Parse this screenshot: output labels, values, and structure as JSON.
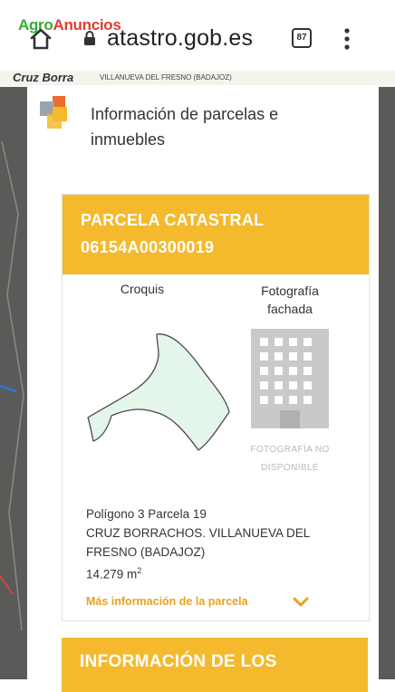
{
  "browser": {
    "url": "atastro.gob.es",
    "tab_count": "87",
    "watermark_part1": "Agro",
    "watermark_part2": "Anuncios"
  },
  "map": {
    "label": "Cruz Borra",
    "sublabel": "VILLANUEVA DEL FRESNO (BADAJOZ)"
  },
  "panel": {
    "title": "Información de parcelas e inmuebles"
  },
  "parcel_card": {
    "heading_line1": "PARCELA CATASTRAL",
    "heading_line2": "06154A00300019",
    "croquis_label": "Croquis",
    "photo_label": "Fotografía fachada",
    "photo_unavailable": "FOTOGRAFÍA NO DISPONIBLE",
    "poligono": "Polígono 3 Parcela 19",
    "address_line1": "CRUZ BORRACHOS. VILLANUEVA DEL",
    "address_line2": "FRESNO (BADAJOZ)",
    "area_value": "14.279 m",
    "area_unit_sup": "2",
    "more_link": "Más información de la parcela"
  },
  "second_card": {
    "heading": "INFORMACIÓN DE LOS"
  },
  "colors": {
    "accent": "#f5b92e",
    "link": "#e9a21f",
    "watermark_green": "#3aa935",
    "watermark_red": "#e03c2f",
    "parcel_fill": "#e4f5e9"
  },
  "icons": [
    "home-icon",
    "lock-icon",
    "tabs-icon",
    "menu-dots-icon",
    "catastro-logo",
    "building-icon",
    "chevron-down-icon"
  ]
}
